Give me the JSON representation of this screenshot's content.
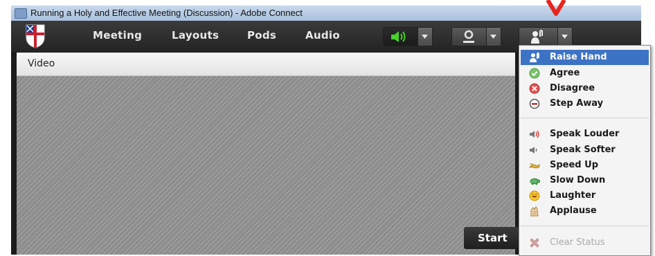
{
  "window": {
    "title": "Running a Holy and Effective Meeting (Discussion) - Adobe Connect"
  },
  "menubar": {
    "items": [
      "Meeting",
      "Layouts",
      "Pods",
      "Audio"
    ],
    "icons": [
      "speaker-icon",
      "webcam-icon",
      "status-icon"
    ]
  },
  "pod": {
    "title": "Video",
    "start_button": "Start"
  },
  "status_menu": {
    "items": [
      {
        "label": "Raise Hand",
        "icon": "raise-hand-icon",
        "selected": true
      },
      {
        "label": "Agree",
        "icon": "agree-icon"
      },
      {
        "label": "Disagree",
        "icon": "disagree-icon"
      },
      {
        "label": "Step Away",
        "icon": "step-away-icon"
      },
      {
        "label": "Speak Louder",
        "icon": "speak-louder-icon"
      },
      {
        "label": "Speak Softer",
        "icon": "speak-softer-icon"
      },
      {
        "label": "Speed Up",
        "icon": "speed-up-icon"
      },
      {
        "label": "Slow Down",
        "icon": "slow-down-icon"
      },
      {
        "label": "Laughter",
        "icon": "laughter-icon"
      },
      {
        "label": "Applause",
        "icon": "applause-icon"
      },
      {
        "label": "Clear Status",
        "icon": "clear-status-icon",
        "disabled": true
      }
    ]
  },
  "colors": {
    "selection": "#3d73c4",
    "annotation_arrow": "#e8251f",
    "speaker_active": "#46d12b"
  }
}
